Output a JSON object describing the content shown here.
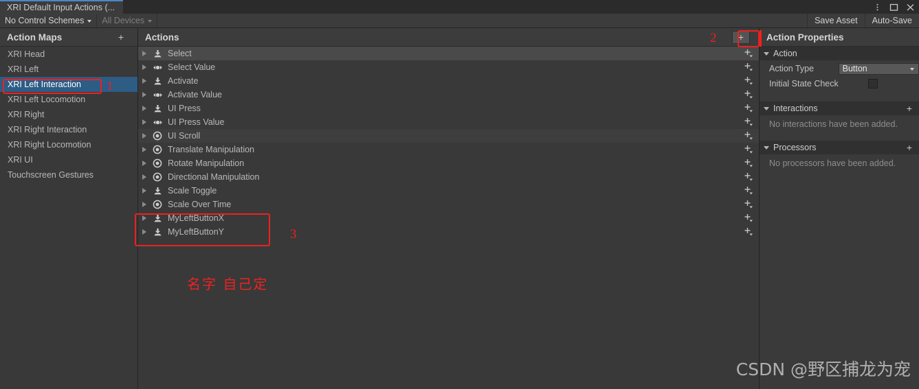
{
  "window": {
    "tab_title": "XRI Default Input Actions (...",
    "menu_icon": "kebab-menu-icon",
    "maximize_icon": "maximize-icon",
    "close_icon": "close-icon"
  },
  "toolbar": {
    "control_schemes_label": "No Control Schemes",
    "devices_label": "All Devices",
    "save_asset_label": "Save Asset",
    "auto_save_label": "Auto-Save"
  },
  "action_maps": {
    "title": "Action Maps",
    "add_label": "+",
    "items": [
      {
        "label": "XRI Head",
        "selected": false
      },
      {
        "label": "XRI Left",
        "selected": false
      },
      {
        "label": "XRI Left Interaction",
        "selected": true
      },
      {
        "label": "XRI Left Locomotion",
        "selected": false
      },
      {
        "label": "XRI Right",
        "selected": false
      },
      {
        "label": "XRI Right Interaction",
        "selected": false
      },
      {
        "label": "XRI Right Locomotion",
        "selected": false
      },
      {
        "label": "XRI UI",
        "selected": false
      },
      {
        "label": "Touchscreen Gestures",
        "selected": false
      }
    ]
  },
  "actions": {
    "title": "Actions",
    "add_label": "+",
    "items": [
      {
        "label": "Select",
        "icon": "button-action-icon"
      },
      {
        "label": "Select Value",
        "icon": "value-action-icon"
      },
      {
        "label": "Activate",
        "icon": "button-action-icon"
      },
      {
        "label": "Activate Value",
        "icon": "value-action-icon"
      },
      {
        "label": "UI Press",
        "icon": "button-action-icon"
      },
      {
        "label": "UI Press Value",
        "icon": "value-action-icon"
      },
      {
        "label": "UI Scroll",
        "icon": "passthrough-action-icon"
      },
      {
        "label": "Translate Manipulation",
        "icon": "passthrough-action-icon"
      },
      {
        "label": "Rotate Manipulation",
        "icon": "passthrough-action-icon"
      },
      {
        "label": "Directional Manipulation",
        "icon": "passthrough-action-icon"
      },
      {
        "label": "Scale Toggle",
        "icon": "button-action-icon"
      },
      {
        "label": "Scale Over Time",
        "icon": "passthrough-action-icon"
      },
      {
        "label": "MyLeftButtonX",
        "icon": "button-action-icon"
      },
      {
        "label": "MyLeftButtonY",
        "icon": "button-action-icon"
      }
    ]
  },
  "properties": {
    "title": "Action Properties",
    "action_section": "Action",
    "action_type_label": "Action Type",
    "action_type_value": "Button",
    "initial_state_label": "Initial State Check",
    "initial_state_checked": false,
    "interactions_section": "Interactions",
    "interactions_empty": "No interactions have been added.",
    "processors_section": "Processors",
    "processors_empty": "No processors have been added.",
    "add_label": "+"
  },
  "annotations": {
    "num_1": "1",
    "num_2": "2",
    "num_3": "3",
    "chinese_note": "名字  自己定",
    "watermark": "CSDN @野区捕龙为宠",
    "highlight_color": "#ef2020"
  }
}
